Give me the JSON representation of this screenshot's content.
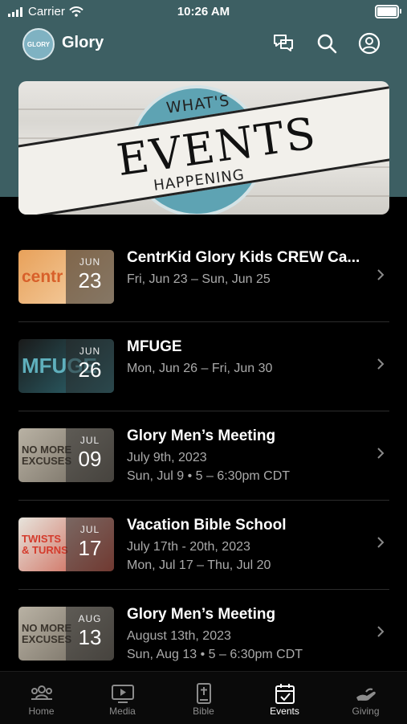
{
  "status_bar": {
    "carrier": "Carrier",
    "time": "10:26 AM"
  },
  "header": {
    "app_title": "Glory",
    "logo_text": "GLORY"
  },
  "banner": {
    "whats": "WHAT'S",
    "events": "EVENTS",
    "happening": "HAPPENING"
  },
  "events": [
    {
      "title": "CentrKid Glory Kids CREW Ca...",
      "lines": [
        "Fri, Jun 23 – Sun, Jun 25"
      ],
      "month": "JUN",
      "day": "23",
      "thumb_text": "centr",
      "thumb_colors": [
        "#e8a15a",
        "#f6d7b0"
      ]
    },
    {
      "title": "MFUGE",
      "lines": [
        "Mon, Jun 26 – Fri, Jun 30"
      ],
      "month": "JUN",
      "day": "26",
      "thumb_text": "MFUGE",
      "thumb_colors": [
        "#1a1a1a",
        "#2f6f7a"
      ]
    },
    {
      "title": "Glory Men’s Meeting",
      "lines": [
        "July 9th, 2023",
        "Sun, Jul 9 • 5 – 6:30pm CDT"
      ],
      "month": "JUL",
      "day": "09",
      "thumb_text": "NO MORE EXCUSES",
      "thumb_colors": [
        "#b9b2a4",
        "#6b6459"
      ]
    },
    {
      "title": "Vacation Bible School",
      "lines": [
        "July 17th - 20th, 2023",
        "Mon, Jul 17 – Thu, Jul 20"
      ],
      "month": "JUL",
      "day": "17",
      "thumb_text": "TWISTS & TURNS",
      "thumb_colors": [
        "#e7e4dc",
        "#c94e3c"
      ]
    },
    {
      "title": "Glory Men’s Meeting",
      "lines": [
        "August 13th, 2023",
        "Sun, Aug 13 • 5 – 6:30pm CDT"
      ],
      "month": "AUG",
      "day": "13",
      "thumb_text": "NO MORE EXCUSES",
      "thumb_colors": [
        "#b9b2a4",
        "#6b6459"
      ]
    }
  ],
  "tabs": [
    {
      "label": "Home",
      "icon": "people-icon"
    },
    {
      "label": "Media",
      "icon": "play-screen-icon"
    },
    {
      "label": "Bible",
      "icon": "bible-icon"
    },
    {
      "label": "Events",
      "icon": "calendar-check-icon",
      "active": true
    },
    {
      "label": "Giving",
      "icon": "giving-hand-icon"
    }
  ],
  "colors": {
    "header_bg": "#3d5f63",
    "banner_circle": "#5ea3b3"
  }
}
